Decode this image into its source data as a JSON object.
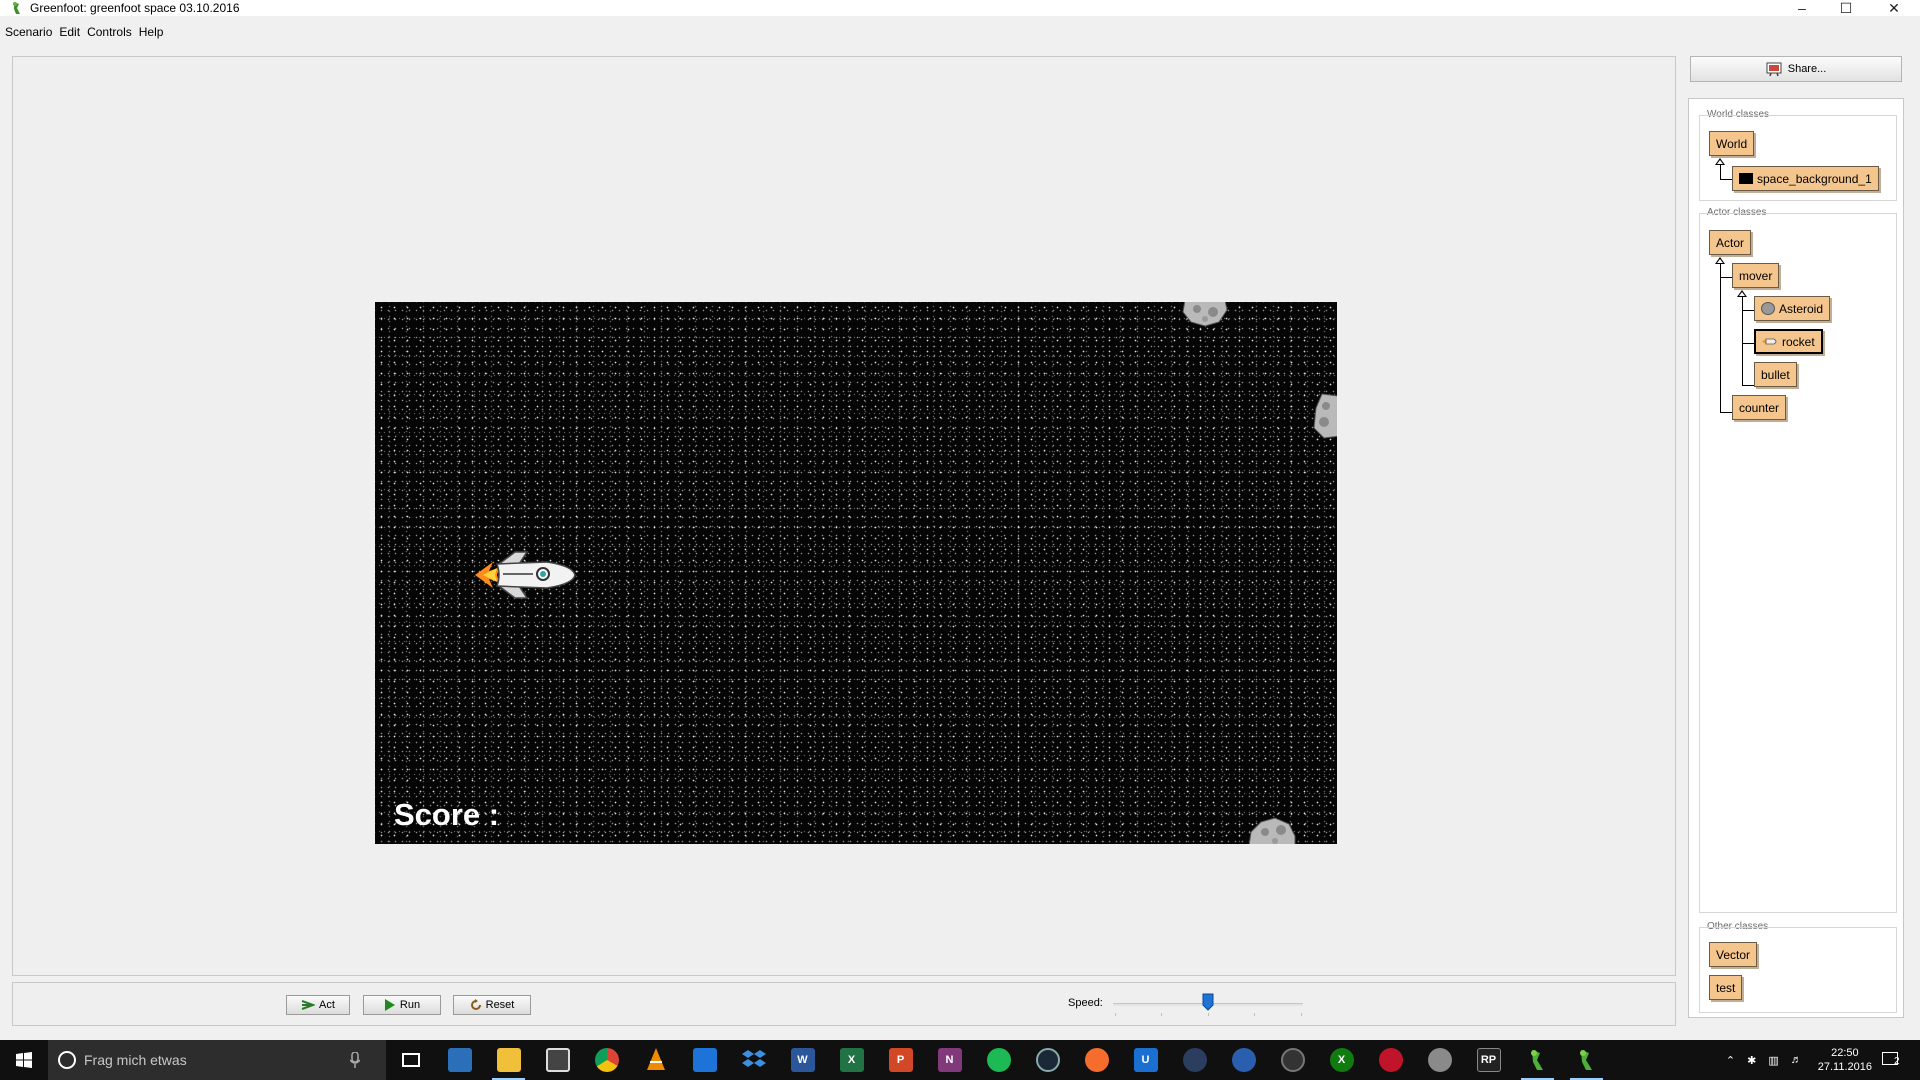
{
  "window": {
    "title": "Greenfoot: greenfoot space 03.10.2016",
    "controls": [
      "minimize",
      "maximize",
      "close"
    ]
  },
  "menu": [
    "Scenario",
    "Edit",
    "Controls",
    "Help"
  ],
  "world": {
    "score_label": "Score :",
    "background_color": "#050505"
  },
  "controls": {
    "act_label": "Act",
    "run_label": "Run",
    "reset_label": "Reset",
    "speed_label": "Speed:",
    "speed_value_fraction": 0.5
  },
  "share_label": "Share...",
  "class_browser": {
    "world_group_label": "World classes",
    "actor_group_label": "Actor classes",
    "other_group_label": "Other classes",
    "world_classes": [
      "World",
      "space_background_1"
    ],
    "actor_classes": [
      "Actor",
      "mover",
      "Asteroid",
      "rocket",
      "bullet",
      "counter"
    ],
    "other_classes": [
      "Vector",
      "test"
    ],
    "selected_class": "rocket",
    "class_color": "#f5c58e"
  },
  "taskbar": {
    "search_placeholder": "Frag mich etwas",
    "time": "22:50",
    "date": "27.11.2016",
    "notification_count": "2",
    "apps": [
      "task-view",
      "explorer-app",
      "file-explorer",
      "calculator",
      "chrome",
      "vlc",
      "dropbox-app",
      "dropbox",
      "word",
      "excel",
      "powerpoint",
      "onenote",
      "spotify",
      "steam",
      "origin",
      "uplay",
      "app-generic-1",
      "app-generic-2",
      "app-generic-3",
      "xbox",
      "app-red",
      "app-mouse",
      "rp",
      "greenfoot-1",
      "greenfoot-2"
    ]
  }
}
